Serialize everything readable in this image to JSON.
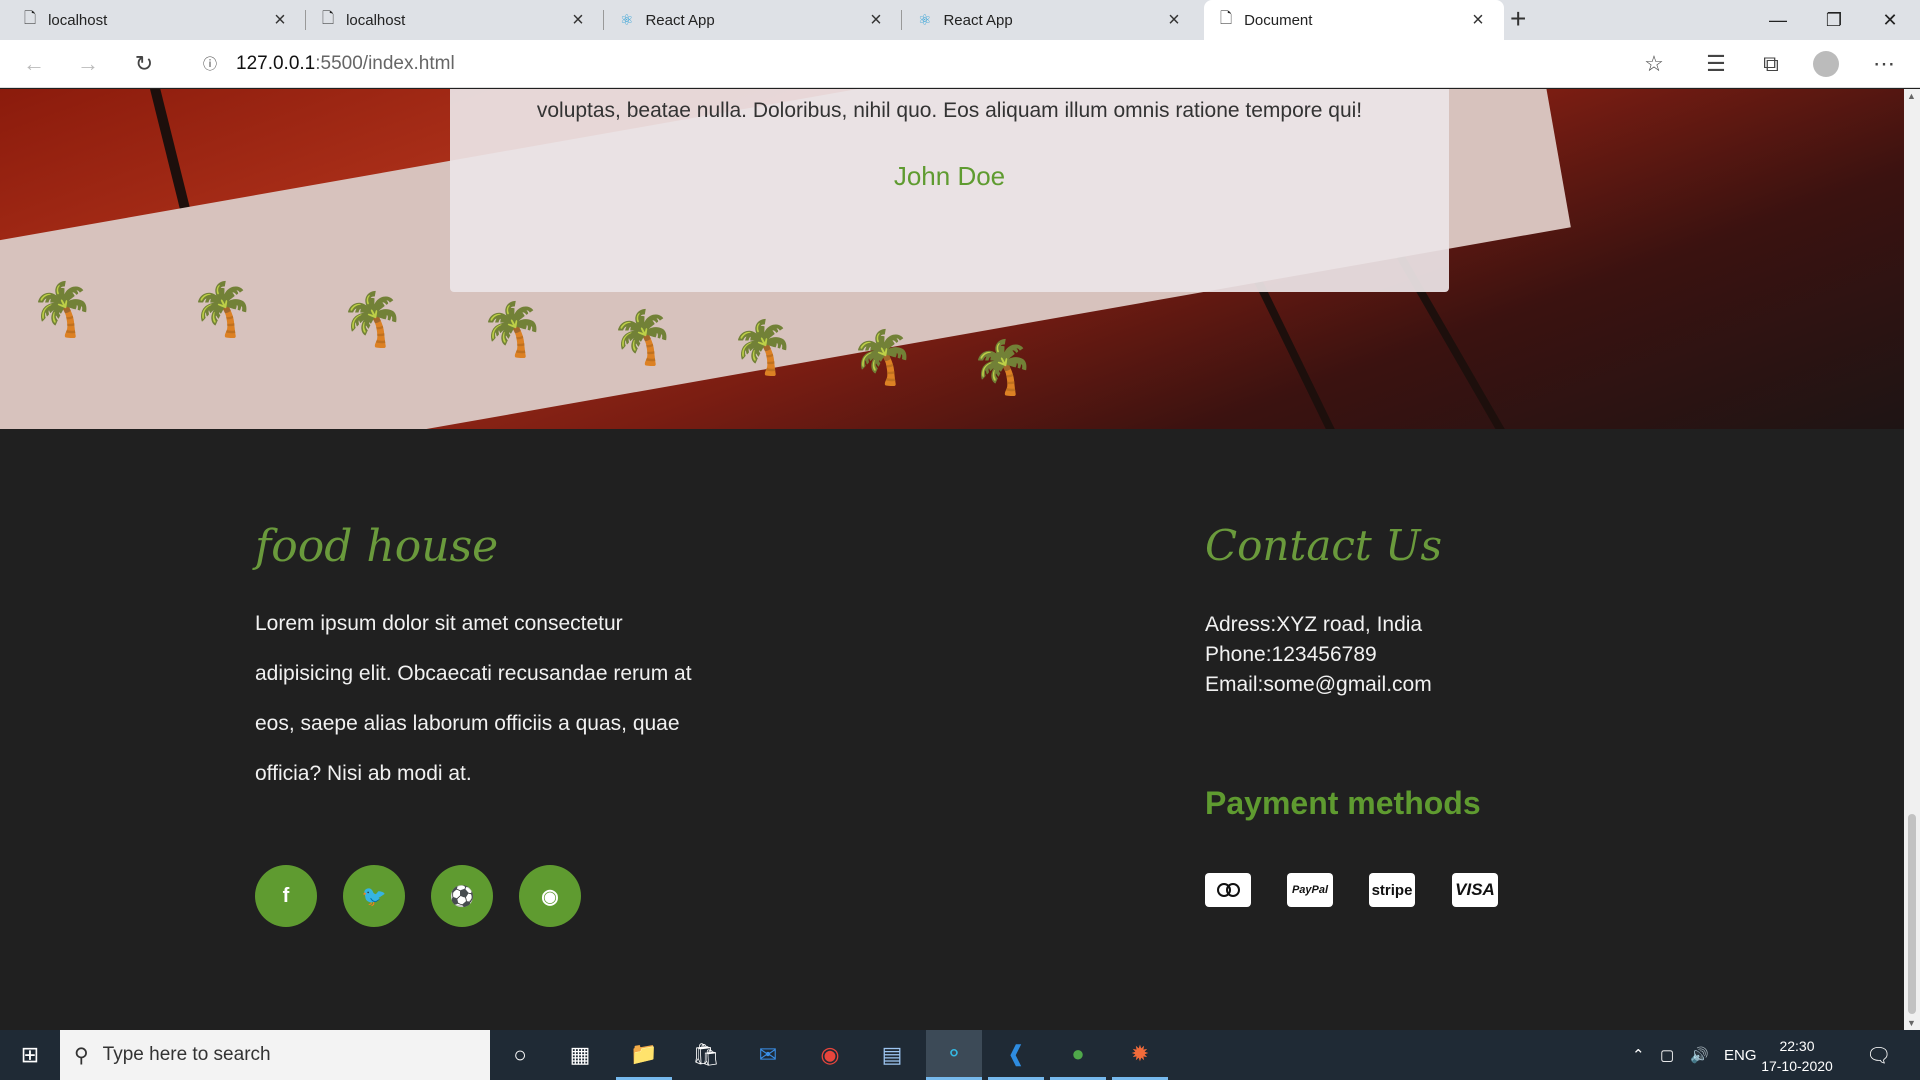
{
  "tabs": [
    {
      "label": "localhost",
      "icon": "page-icon"
    },
    {
      "label": "localhost",
      "icon": "page-icon"
    },
    {
      "label": "React App",
      "icon": "react-icon"
    },
    {
      "label": "React App",
      "icon": "react-icon"
    },
    {
      "label": "Document",
      "icon": "page-icon",
      "active": true
    }
  ],
  "address": {
    "host": "127.0.0.1",
    "rest": ":5500/index.html"
  },
  "testimonial": {
    "quote": "voluptas, beatae nulla. Doloribus, nihil quo. Eos aliquam illum omnis ratione tempore qui!",
    "name": "John Doe"
  },
  "footer": {
    "brand": "food house",
    "about": "Lorem ipsum dolor sit amet consectetur adipisicing elit. Obcaecati recusandae rerum at eos, saepe alias laborum officiis a quas, quae officia? Nisi ab modi at.",
    "social": [
      "facebook",
      "twitter",
      "dribbble",
      "instagram"
    ],
    "contact_title": "Contact Us",
    "address": "Adress:XYZ road, India",
    "phone": "Phone:123456789",
    "email": "Email:some@gmail.com",
    "payment_title": "Payment methods",
    "payments": [
      "mastercard",
      "PayPal",
      "stripe",
      "VISA"
    ]
  },
  "taskbar": {
    "search_placeholder": "Type here to search",
    "lang": "ENG",
    "time": "22:30",
    "date": "17-10-2020"
  },
  "colors": {
    "accent": "#5f9b30",
    "footer_bg": "#202020",
    "taskbar": "#1f2a35"
  }
}
